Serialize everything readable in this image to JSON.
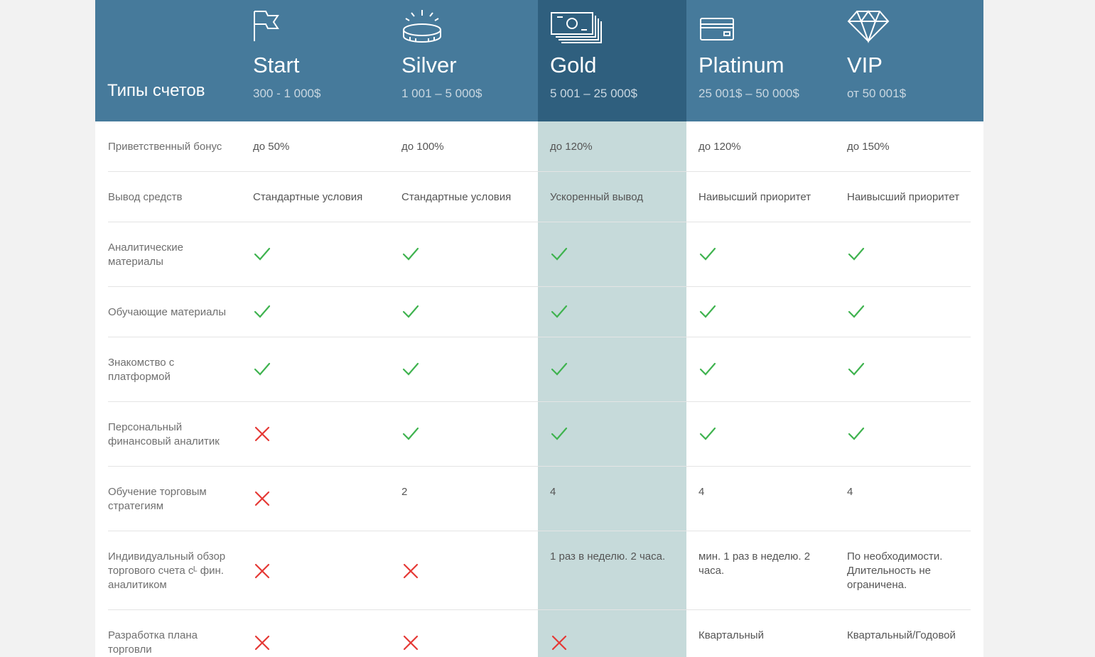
{
  "table_title": "Типы счетов",
  "colors": {
    "header": "#467a9b",
    "header_highlight": "#2f5f7e",
    "column_highlight": "#c6dada",
    "check": "#3fb34f",
    "cross": "#e53935"
  },
  "plans": [
    {
      "name": "Start",
      "range": "300 - 1 000$",
      "icon": "flag-icon"
    },
    {
      "name": "Silver",
      "range": "1 001 – 5 000$",
      "icon": "coin-icon"
    },
    {
      "name": "Gold",
      "range": "5 001 – 25 000$",
      "icon": "banknotes-icon",
      "highlighted": true
    },
    {
      "name": "Platinum",
      "range": "25 001$ – 50 000$",
      "icon": "credit-card-icon"
    },
    {
      "name": "VIP",
      "range": "от 50 001$",
      "icon": "diamond-icon"
    }
  ],
  "rows": [
    {
      "label": "Приветственный бонус",
      "cells": [
        {
          "type": "text",
          "value": "до 50%"
        },
        {
          "type": "text",
          "value": "до 100%"
        },
        {
          "type": "text",
          "value": "до 120%"
        },
        {
          "type": "text",
          "value": "до 120%"
        },
        {
          "type": "text",
          "value": "до 150%"
        }
      ]
    },
    {
      "label": "Вывод средств",
      "cells": [
        {
          "type": "text",
          "value": "Стандартные условия"
        },
        {
          "type": "text",
          "value": "Стандартные условия"
        },
        {
          "type": "text",
          "value": "Ускоренный вывод"
        },
        {
          "type": "text",
          "value": "Наивысший приоритет"
        },
        {
          "type": "text",
          "value": "Наивысший приоритет"
        }
      ]
    },
    {
      "label": "Аналитические материалы",
      "cells": [
        {
          "type": "check"
        },
        {
          "type": "check"
        },
        {
          "type": "check"
        },
        {
          "type": "check"
        },
        {
          "type": "check"
        }
      ]
    },
    {
      "label": "Обучающие материалы",
      "cells": [
        {
          "type": "check"
        },
        {
          "type": "check"
        },
        {
          "type": "check"
        },
        {
          "type": "check"
        },
        {
          "type": "check"
        }
      ]
    },
    {
      "label": "Знакомство с платформой",
      "cells": [
        {
          "type": "check"
        },
        {
          "type": "check"
        },
        {
          "type": "check"
        },
        {
          "type": "check"
        },
        {
          "type": "check"
        }
      ]
    },
    {
      "label": "Персональный финансовый аналитик",
      "cells": [
        {
          "type": "cross"
        },
        {
          "type": "check"
        },
        {
          "type": "check"
        },
        {
          "type": "check"
        },
        {
          "type": "check"
        }
      ]
    },
    {
      "label": "Обучение торговым стратегиям",
      "cells": [
        {
          "type": "cross"
        },
        {
          "type": "text",
          "value": "2"
        },
        {
          "type": "text",
          "value": "4"
        },
        {
          "type": "text",
          "value": "4"
        },
        {
          "type": "text",
          "value": "4"
        }
      ]
    },
    {
      "label": "Индивидуальный обзор торгового счета сᴸ фин. аналитиком",
      "cells": [
        {
          "type": "cross"
        },
        {
          "type": "cross"
        },
        {
          "type": "text",
          "value": "1 раз в неделю. 2 часа."
        },
        {
          "type": "text",
          "value": "мин. 1 раз в неделю. 2 часа."
        },
        {
          "type": "text",
          "value": "По необходимости. Длительность не ограничена."
        }
      ]
    },
    {
      "label": "Разработка плана торговли",
      "cells": [
        {
          "type": "cross"
        },
        {
          "type": "cross"
        },
        {
          "type": "cross"
        },
        {
          "type": "text",
          "value": "Квартальный"
        },
        {
          "type": "text",
          "value": "Квартальный/Годовой"
        }
      ]
    }
  ]
}
